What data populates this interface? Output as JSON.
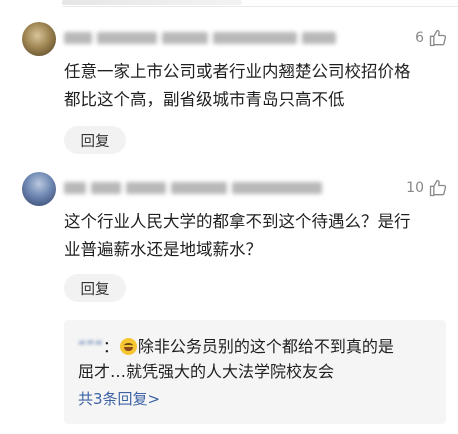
{
  "comments": [
    {
      "likes": "6",
      "text_line1": "任意一家上市公司或者行业内翘楚公司校招价格",
      "text_line2": "都比这个高，副省级城市青岛只高不低",
      "reply_label": "回复"
    },
    {
      "likes": "10",
      "text_line1": "这个行业人民大学的都拿不到这个待遇么？是行",
      "text_line2": "业普遍薪水还是地域薪水？",
      "reply_label": "回复"
    }
  ],
  "subreply": {
    "author": "“”“",
    "separator": "：",
    "text_part1": "除非公务员别的这个都给不到真的是",
    "text_line2": "屈才…就凭强大的人大法学院校友会",
    "more_label": "共3条回复>"
  },
  "colors": {
    "link": "#3d63a6",
    "reply_bg": "#f2f2f2",
    "subreply_bg": "#f5f5f5"
  },
  "icons": [
    "thumbs-up-icon",
    "laughing-emoji"
  ]
}
